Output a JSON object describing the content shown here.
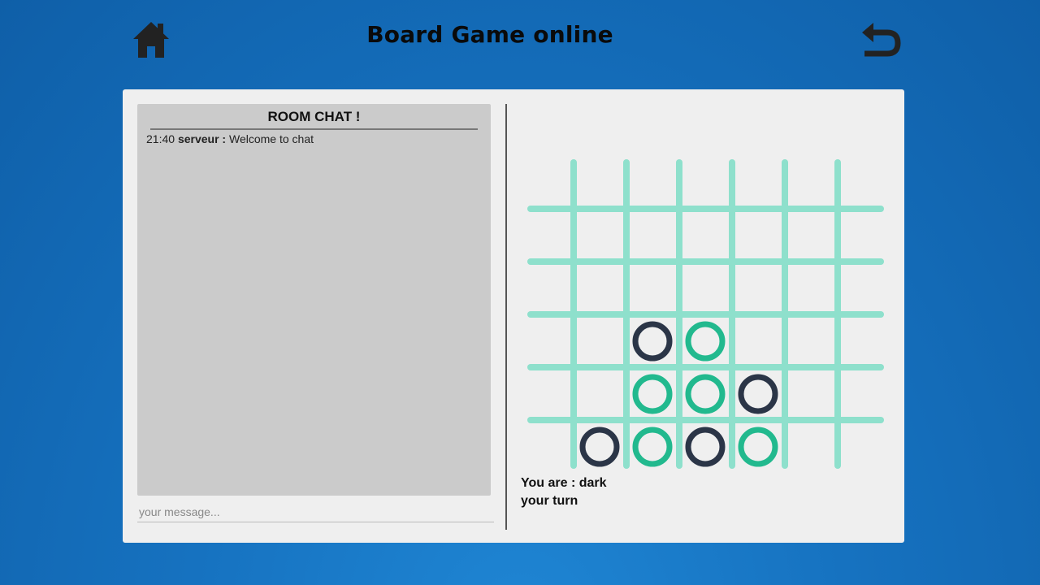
{
  "header": {
    "title": "Board Game online",
    "home_icon": "home-icon",
    "back_icon": "undo-arrow-icon"
  },
  "chat": {
    "title": "ROOM CHAT !",
    "messages": [
      {
        "time": "21:40",
        "author": "serveur :",
        "text": "Welcome to chat"
      }
    ],
    "input_placeholder": "your message...",
    "input_value": ""
  },
  "game": {
    "columns": 6,
    "rows": 6,
    "grid_color": "#8ee0cc",
    "dark_color": "#2b3547",
    "green_color": "#22b98e",
    "pieces": [
      {
        "col": 1,
        "row": 3,
        "player": "dark"
      },
      {
        "col": 2,
        "row": 3,
        "player": "green"
      },
      {
        "col": 1,
        "row": 4,
        "player": "green"
      },
      {
        "col": 2,
        "row": 4,
        "player": "green"
      },
      {
        "col": 3,
        "row": 4,
        "player": "dark"
      },
      {
        "col": 0,
        "row": 5,
        "player": "dark"
      },
      {
        "col": 1,
        "row": 5,
        "player": "green"
      },
      {
        "col": 2,
        "row": 5,
        "player": "dark"
      },
      {
        "col": 3,
        "row": 5,
        "player": "green"
      }
    ],
    "player_label": "You are : dark",
    "turn_label": "your turn"
  },
  "colors": {
    "background": "#1672c0",
    "panel": "#efefef",
    "chat_box": "#cbcbcb"
  }
}
